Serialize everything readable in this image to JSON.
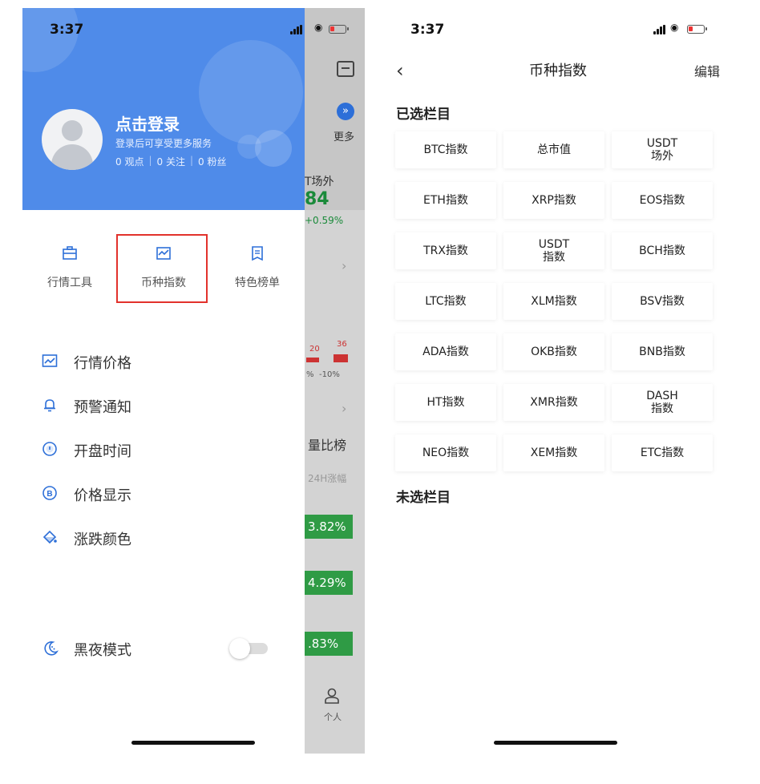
{
  "status_bar": {
    "time": "3:37"
  },
  "drawer": {
    "login_title": "点击登录",
    "login_subtitle": "登录后可享受更多服务",
    "stats": {
      "views": "0 观点",
      "follows": "0 关注",
      "fans": "0 粉丝",
      "separator": "|"
    },
    "quick_tools": [
      {
        "label": "行情工具",
        "icon": "toolbox-icon"
      },
      {
        "label": "币种指数",
        "icon": "chart-frame-icon"
      },
      {
        "label": "特色榜单",
        "icon": "ribbon-list-icon"
      }
    ],
    "menu": [
      {
        "label": "行情价格",
        "icon": "price-chart-icon"
      },
      {
        "label": "预警通知",
        "icon": "bell-icon"
      },
      {
        "label": "开盘时间",
        "icon": "clock-icon"
      },
      {
        "label": "价格显示",
        "icon": "bitcoin-coin-icon"
      },
      {
        "label": "涨跌颜色",
        "icon": "paint-bucket-icon"
      }
    ],
    "night_mode": {
      "label": "黑夜模式",
      "enabled": false,
      "icon": "moon-icon"
    }
  },
  "underlay": {
    "more_label": "更多",
    "ut_title": "T场外",
    "ut_value": "84",
    "ut_change": "+0.59%",
    "bar_values": [
      "20",
      "36"
    ],
    "pct_labels": [
      "%",
      "-10%"
    ],
    "rank_title": "量比榜",
    "rank_sub": "24H涨幅",
    "badges": [
      "3.82%",
      "4.29%",
      ".83%"
    ],
    "person_label": "个人"
  },
  "index_page": {
    "title": "币种指数",
    "back_glyph": "‹",
    "edit_label": "编辑",
    "selected_title": "已选栏目",
    "unselected_title": "未选栏目",
    "selected": [
      "BTC指数",
      "总市值",
      "USDT\n场外",
      "ETH指数",
      "XRP指数",
      "EOS指数",
      "TRX指数",
      "USDT\n指数",
      "BCH指数",
      "LTC指数",
      "XLM指数",
      "BSV指数",
      "ADA指数",
      "OKB指数",
      "BNB指数",
      "HT指数",
      "XMR指数",
      "DASH\n指数",
      "NEO指数",
      "XEM指数",
      "ETC指数"
    ]
  },
  "colors": {
    "header_blue": "#4f8be9",
    "accent_blue": "#2d6fd8",
    "highlight_red": "#e2322c",
    "up_green": "#2f9b45"
  }
}
